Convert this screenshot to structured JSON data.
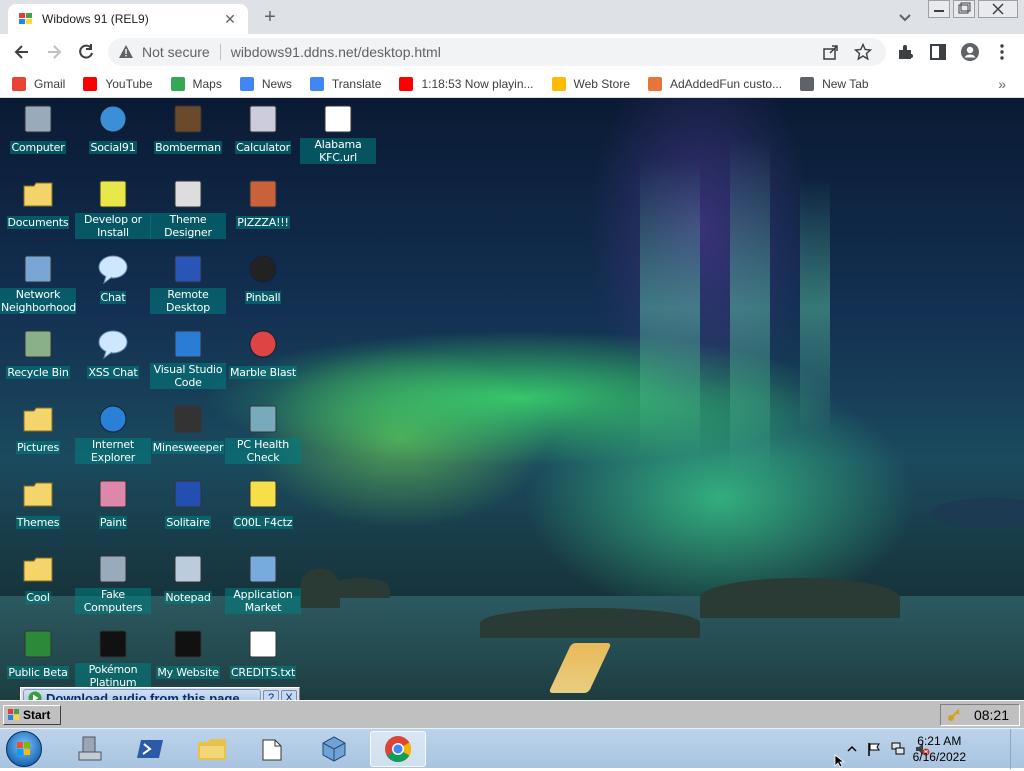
{
  "browser": {
    "tab": {
      "title": "Wibdows 91 (REL9)",
      "favicon": "wibdows-favicon-icon"
    },
    "address": {
      "security_text": "Not secure",
      "url": "wibdows91.ddns.net/desktop.html"
    },
    "bookmarks": [
      {
        "label": "Gmail",
        "icon": "gmail-icon",
        "color": "#ea4335"
      },
      {
        "label": "YouTube",
        "icon": "youtube-icon",
        "color": "#ff0000"
      },
      {
        "label": "Maps",
        "icon": "maps-icon",
        "color": "#34a853"
      },
      {
        "label": "News",
        "icon": "news-icon",
        "color": "#4285f4"
      },
      {
        "label": "Translate",
        "icon": "translate-icon",
        "color": "#4285f4"
      },
      {
        "label": "1:18:53 Now playin...",
        "icon": "youtube-icon",
        "color": "#ff0000"
      },
      {
        "label": "Web Store",
        "icon": "webstore-icon",
        "color": "#fbbc05"
      },
      {
        "label": "AdAddedFun custo...",
        "icon": "adaddedfun-icon",
        "color": "#e8743b"
      },
      {
        "label": "New Tab",
        "icon": "globe-icon",
        "color": "#5f6368"
      }
    ],
    "bookmarks_more": "»"
  },
  "desktop": {
    "icons": [
      {
        "label": "Computer",
        "icon": "computer-icon"
      },
      {
        "label": "Social91",
        "icon": "globe-icon"
      },
      {
        "label": "Bomberman",
        "icon": "bomberman-icon"
      },
      {
        "label": "Calculator",
        "icon": "calculator-icon"
      },
      {
        "label": "Alabama KFC.url",
        "icon": "ie-url-icon"
      },
      {
        "label": "Documents",
        "icon": "folder-documents-icon"
      },
      {
        "label": "Develop or Install",
        "icon": "develop-icon"
      },
      {
        "label": "Theme Designer",
        "icon": "window-icon"
      },
      {
        "label": "PIZZZA!!!",
        "icon": "pizza-icon"
      },
      {
        "label": "Network Neighborhood",
        "icon": "network-icon"
      },
      {
        "label": "Chat",
        "icon": "chat-bubble-icon"
      },
      {
        "label": "Remote Desktop",
        "icon": "remote-desktop-icon"
      },
      {
        "label": "Pinball",
        "icon": "pinball-icon"
      },
      {
        "label": "Recycle Bin",
        "icon": "recycle-bin-icon"
      },
      {
        "label": "XSS Chat",
        "icon": "xss-chat-icon"
      },
      {
        "label": "Visual Studio Code",
        "icon": "vscode-icon"
      },
      {
        "label": "Marble Blast",
        "icon": "marble-icon"
      },
      {
        "label": "Pictures",
        "icon": "folder-icon"
      },
      {
        "label": "Internet Explorer",
        "icon": "ie-icon"
      },
      {
        "label": "Minesweeper",
        "icon": "mine-icon"
      },
      {
        "label": "PC Health Check",
        "icon": "health-check-icon"
      },
      {
        "label": "Themes",
        "icon": "folder-icon"
      },
      {
        "label": "Paint",
        "icon": "paint-icon"
      },
      {
        "label": "Solitaire",
        "icon": "solitaire-icon"
      },
      {
        "label": "C00L F4ctz",
        "icon": "lightbulb-icon"
      },
      {
        "label": "Cool",
        "icon": "folder-icon"
      },
      {
        "label": "Fake Computers",
        "icon": "computer-icon"
      },
      {
        "label": "Notepad",
        "icon": "notepad-icon"
      },
      {
        "label": "Application Market",
        "icon": "market-icon"
      },
      {
        "label": "Public Beta",
        "icon": "public-beta-icon"
      },
      {
        "label": "Pokémon Platinum",
        "icon": "pokemon-icon"
      },
      {
        "label": "My Website",
        "icon": "github-icon"
      },
      {
        "label": "CREDITS.txt",
        "icon": "text-file-icon"
      }
    ],
    "popup": {
      "label": "Download audio from this page",
      "help": "?",
      "close": "X"
    },
    "w95_taskbar": {
      "start": "Start",
      "time": "08:21"
    }
  },
  "os_taskbar": {
    "pinned": [
      "start-orb-icon",
      "server-manager-icon",
      "powershell-icon",
      "file-explorer-icon",
      "folder-window-icon",
      "virtualbox-icon",
      "chrome-icon"
    ],
    "clock_time": "6:21 AM",
    "clock_date": "6/16/2022"
  }
}
